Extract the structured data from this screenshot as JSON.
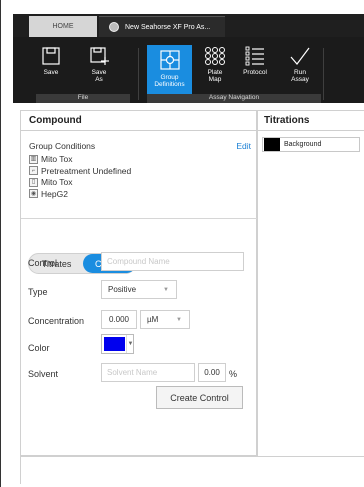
{
  "tabs": {
    "home": "HOME",
    "document": "New Seahorse XF Pro As..."
  },
  "ribbon": {
    "save": "Save",
    "save_as_line1": "Save",
    "save_as_line2": "As",
    "group_definitions_line1": "Group",
    "group_definitions_line2": "Definitions",
    "plate_map_line1": "Plate",
    "plate_map_line2": "Map",
    "protocol": "Protocol",
    "run_assay_line1": "Run",
    "run_assay_line2": "Assay",
    "group_file": "File",
    "group_assay_navigation": "Assay Navigation",
    "accent": "#1a8de0"
  },
  "compound": {
    "title": "Compound",
    "group_conditions_label": "Group Conditions",
    "edit_label": "Edit",
    "conditions": [
      "Mito Tox",
      "Pretreatment Undefined",
      "Mito Tox",
      "HepG2"
    ],
    "condition_icons": [
      "assay-icon",
      "pretreatment-icon",
      "media-icon",
      "cell-icon"
    ]
  },
  "toggle": {
    "titrates": "Titrates",
    "control": "Control",
    "selected": "Control"
  },
  "form": {
    "control_label": "Control",
    "compound_name_placeholder": "Compound Name",
    "type_label": "Type",
    "type_value": "Positive",
    "concentration_label": "Concentration",
    "concentration_value": "0.000",
    "unit_value": "µM",
    "color_label": "Color",
    "color_value": "#0000ee",
    "solvent_label": "Solvent",
    "solvent_name_placeholder": "Solvent Name",
    "solvent_pct_value": "0.00",
    "pct_symbol": "%",
    "create_button": "Create Control"
  },
  "titrations": {
    "title": "Titrations",
    "items": [
      {
        "label": "Background",
        "color": "#000000"
      }
    ]
  }
}
